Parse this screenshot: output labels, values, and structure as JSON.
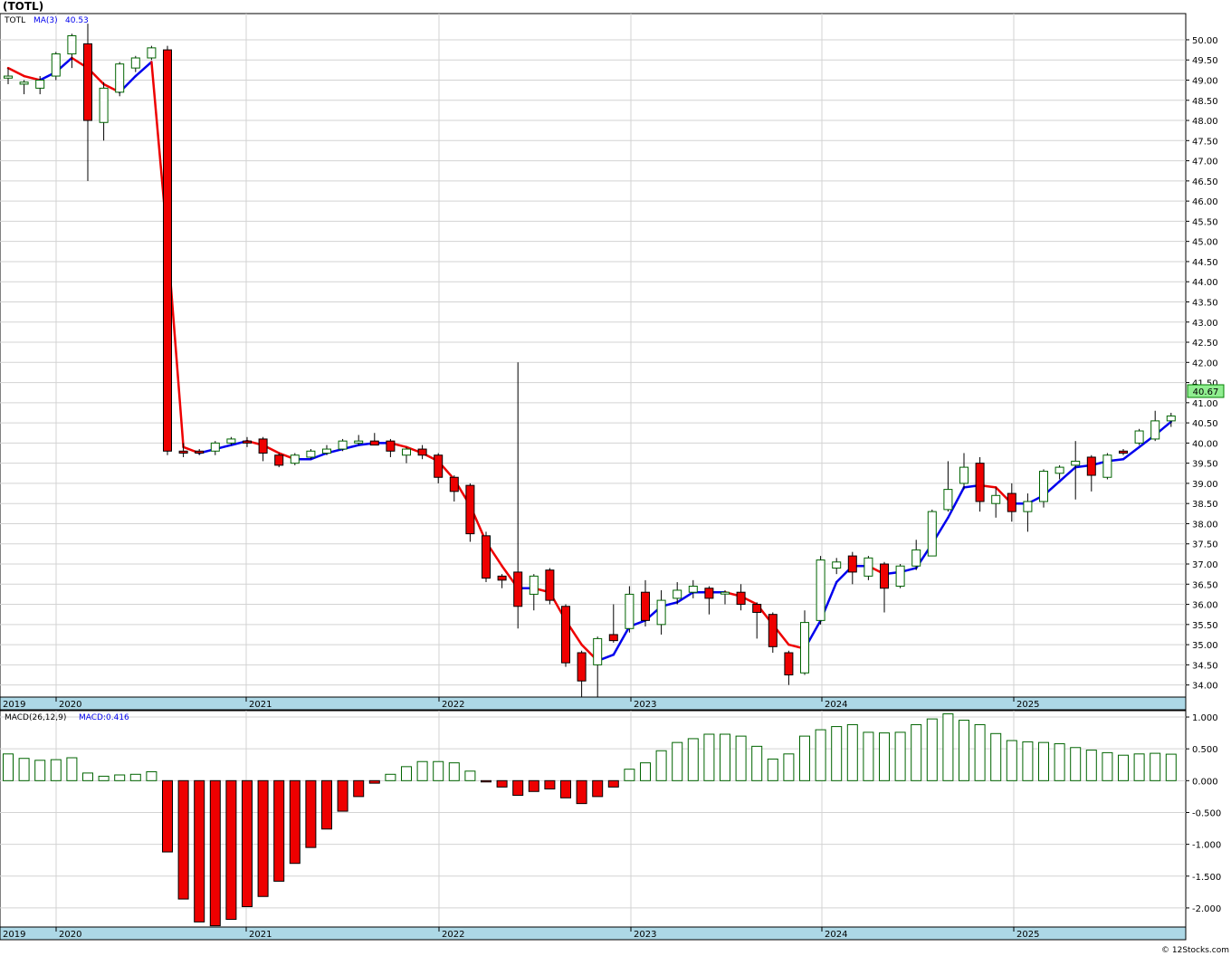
{
  "chart_data": [
    {
      "type": "candlestick",
      "title": "(TOTL)",
      "legend": {
        "symbol": "TOTL",
        "ma_label": "MA(3)",
        "ma_value": "40.53"
      },
      "last_price_label": "40.67",
      "ylim": [
        33.7,
        50.65
      ],
      "y_ticks": [
        "34.00",
        "34.50",
        "35.00",
        "35.50",
        "36.00",
        "36.50",
        "37.00",
        "37.50",
        "38.00",
        "38.50",
        "39.00",
        "39.50",
        "40.00",
        "40.50",
        "41.00",
        "41.50",
        "42.00",
        "42.50",
        "43.00",
        "43.50",
        "44.00",
        "44.50",
        "45.00",
        "45.50",
        "46.00",
        "46.50",
        "47.00",
        "47.50",
        "48.00",
        "48.50",
        "49.00",
        "49.50",
        "50.00"
      ],
      "x_labels": [
        "2019",
        "2020",
        "2021",
        "2022",
        "2023",
        "2024",
        "2025"
      ],
      "year_tick_positions_months": [
        0,
        3,
        15,
        27,
        39,
        51,
        63
      ],
      "candles": [
        {
          "m": 0,
          "o": 49.05,
          "h": 49.3,
          "l": 48.9,
          "c": 49.1
        },
        {
          "m": 1,
          "o": 48.9,
          "h": 49.0,
          "l": 48.65,
          "c": 48.95
        },
        {
          "m": 2,
          "o": 48.8,
          "h": 49.1,
          "l": 48.65,
          "c": 49.0
        },
        {
          "m": 3,
          "o": 49.1,
          "h": 49.7,
          "l": 49.0,
          "c": 49.65
        },
        {
          "m": 4,
          "o": 49.65,
          "h": 50.15,
          "l": 49.3,
          "c": 50.1
        },
        {
          "m": 5,
          "o": 49.9,
          "h": 50.4,
          "l": 46.5,
          "c": 48.0
        },
        {
          "m": 6,
          "o": 47.95,
          "h": 48.95,
          "l": 47.5,
          "c": 48.8
        },
        {
          "m": 7,
          "o": 48.7,
          "h": 49.45,
          "l": 48.6,
          "c": 49.4
        },
        {
          "m": 8,
          "o": 49.3,
          "h": 49.6,
          "l": 49.2,
          "c": 49.55
        },
        {
          "m": 9,
          "o": 49.55,
          "h": 49.85,
          "l": 49.5,
          "c": 49.8
        },
        {
          "m": 10,
          "o": 49.75,
          "h": 49.85,
          "l": 39.7,
          "c": 39.8
        },
        {
          "m": 11,
          "o": 39.8,
          "h": 40.0,
          "l": 39.65,
          "c": 39.75
        },
        {
          "m": 12,
          "o": 39.8,
          "h": 39.85,
          "l": 39.7,
          "c": 39.75
        },
        {
          "m": 13,
          "o": 39.8,
          "h": 40.05,
          "l": 39.7,
          "c": 40.0
        },
        {
          "m": 14,
          "o": 40.0,
          "h": 40.15,
          "l": 39.95,
          "c": 40.1
        },
        {
          "m": 15,
          "o": 40.05,
          "h": 40.15,
          "l": 39.9,
          "c": 40.0
        },
        {
          "m": 16,
          "o": 40.1,
          "h": 40.15,
          "l": 39.55,
          "c": 39.75
        },
        {
          "m": 17,
          "o": 39.7,
          "h": 39.75,
          "l": 39.4,
          "c": 39.45
        },
        {
          "m": 18,
          "o": 39.5,
          "h": 39.75,
          "l": 39.45,
          "c": 39.7
        },
        {
          "m": 19,
          "o": 39.65,
          "h": 39.85,
          "l": 39.6,
          "c": 39.8
        },
        {
          "m": 20,
          "o": 39.75,
          "h": 39.95,
          "l": 39.7,
          "c": 39.85
        },
        {
          "m": 21,
          "o": 39.85,
          "h": 40.1,
          "l": 39.8,
          "c": 40.05
        },
        {
          "m": 22,
          "o": 40.0,
          "h": 40.2,
          "l": 39.95,
          "c": 40.05
        },
        {
          "m": 23,
          "o": 40.05,
          "h": 40.25,
          "l": 39.95,
          "c": 39.95
        },
        {
          "m": 24,
          "o": 40.05,
          "h": 40.1,
          "l": 39.65,
          "c": 39.8
        },
        {
          "m": 25,
          "o": 39.7,
          "h": 39.9,
          "l": 39.5,
          "c": 39.85
        },
        {
          "m": 26,
          "o": 39.85,
          "h": 39.95,
          "l": 39.6,
          "c": 39.7
        },
        {
          "m": 27,
          "o": 39.7,
          "h": 39.75,
          "l": 39.0,
          "c": 39.15
        },
        {
          "m": 28,
          "o": 39.15,
          "h": 39.2,
          "l": 38.55,
          "c": 38.8
        },
        {
          "m": 29,
          "o": 38.95,
          "h": 39.0,
          "l": 37.55,
          "c": 37.75
        },
        {
          "m": 30,
          "o": 37.7,
          "h": 37.8,
          "l": 36.55,
          "c": 36.65
        },
        {
          "m": 31,
          "o": 36.7,
          "h": 36.75,
          "l": 36.4,
          "c": 36.6
        },
        {
          "m": 32,
          "o": 36.8,
          "h": 42.0,
          "l": 35.4,
          "c": 35.95
        },
        {
          "m": 33,
          "o": 36.25,
          "h": 36.75,
          "l": 35.85,
          "c": 36.7
        },
        {
          "m": 34,
          "o": 36.85,
          "h": 36.9,
          "l": 36.0,
          "c": 36.1
        },
        {
          "m": 35,
          "o": 35.95,
          "h": 36.0,
          "l": 34.45,
          "c": 34.55
        },
        {
          "m": 36,
          "o": 34.8,
          "h": 34.85,
          "l": 33.7,
          "c": 34.1
        },
        {
          "m": 37,
          "o": 34.5,
          "h": 35.2,
          "l": 33.65,
          "c": 35.15
        },
        {
          "m": 38,
          "o": 35.25,
          "h": 36.0,
          "l": 35.05,
          "c": 35.1
        },
        {
          "m": 39,
          "o": 35.4,
          "h": 36.45,
          "l": 35.3,
          "c": 36.25
        },
        {
          "m": 40,
          "o": 36.3,
          "h": 36.6,
          "l": 35.45,
          "c": 35.6
        },
        {
          "m": 41,
          "o": 35.5,
          "h": 36.35,
          "l": 35.25,
          "c": 36.1
        },
        {
          "m": 42,
          "o": 36.15,
          "h": 36.55,
          "l": 36.0,
          "c": 36.35
        },
        {
          "m": 43,
          "o": 36.3,
          "h": 36.6,
          "l": 36.15,
          "c": 36.45
        },
        {
          "m": 44,
          "o": 36.4,
          "h": 36.45,
          "l": 35.75,
          "c": 36.15
        },
        {
          "m": 45,
          "o": 36.3,
          "h": 36.35,
          "l": 36.0,
          "c": 36.3
        },
        {
          "m": 46,
          "o": 36.3,
          "h": 36.5,
          "l": 35.85,
          "c": 36.0
        },
        {
          "m": 47,
          "o": 36.0,
          "h": 36.05,
          "l": 35.15,
          "c": 35.8
        },
        {
          "m": 48,
          "o": 35.75,
          "h": 35.8,
          "l": 34.8,
          "c": 34.95
        },
        {
          "m": 49,
          "o": 34.8,
          "h": 34.85,
          "l": 34.0,
          "c": 34.25
        },
        {
          "m": 50,
          "o": 34.3,
          "h": 35.85,
          "l": 34.25,
          "c": 35.55
        },
        {
          "m": 51,
          "o": 35.6,
          "h": 37.2,
          "l": 35.5,
          "c": 37.1
        },
        {
          "m": 52,
          "o": 36.9,
          "h": 37.15,
          "l": 36.75,
          "c": 37.05
        },
        {
          "m": 53,
          "o": 37.2,
          "h": 37.3,
          "l": 36.5,
          "c": 36.8
        },
        {
          "m": 54,
          "o": 36.7,
          "h": 37.2,
          "l": 36.6,
          "c": 37.15
        },
        {
          "m": 55,
          "o": 37.0,
          "h": 37.05,
          "l": 35.8,
          "c": 36.4
        },
        {
          "m": 56,
          "o": 36.45,
          "h": 37.0,
          "l": 36.4,
          "c": 36.95
        },
        {
          "m": 57,
          "o": 36.95,
          "h": 37.6,
          "l": 36.85,
          "c": 37.35
        },
        {
          "m": 58,
          "o": 37.2,
          "h": 38.35,
          "l": 37.2,
          "c": 38.3
        },
        {
          "m": 59,
          "o": 38.35,
          "h": 39.55,
          "l": 38.3,
          "c": 38.85
        },
        {
          "m": 60,
          "o": 39.0,
          "h": 39.75,
          "l": 38.85,
          "c": 39.4
        },
        {
          "m": 61,
          "o": 39.5,
          "h": 39.65,
          "l": 38.3,
          "c": 38.55
        },
        {
          "m": 62,
          "o": 38.5,
          "h": 38.9,
          "l": 38.15,
          "c": 38.7
        },
        {
          "m": 63,
          "o": 38.75,
          "h": 39.0,
          "l": 38.05,
          "c": 38.3
        },
        {
          "m": 64,
          "o": 38.3,
          "h": 38.75,
          "l": 37.8,
          "c": 38.55
        },
        {
          "m": 65,
          "o": 38.55,
          "h": 39.35,
          "l": 38.4,
          "c": 39.3
        },
        {
          "m": 66,
          "o": 39.25,
          "h": 39.45,
          "l": 39.1,
          "c": 39.4
        },
        {
          "m": 67,
          "o": 39.45,
          "h": 40.05,
          "l": 38.6,
          "c": 39.55
        },
        {
          "m": 68,
          "o": 39.65,
          "h": 39.7,
          "l": 38.8,
          "c": 39.2
        },
        {
          "m": 69,
          "o": 39.15,
          "h": 39.75,
          "l": 39.1,
          "c": 39.7
        },
        {
          "m": 70,
          "o": 39.8,
          "h": 39.85,
          "l": 39.7,
          "c": 39.75
        },
        {
          "m": 71,
          "o": 40.0,
          "h": 40.35,
          "l": 39.95,
          "c": 40.3
        },
        {
          "m": 72,
          "o": 40.1,
          "h": 40.8,
          "l": 40.05,
          "c": 40.55
        },
        {
          "m": 73,
          "o": 40.55,
          "h": 40.75,
          "l": 40.4,
          "c": 40.67
        }
      ],
      "ma3": [
        49.3,
        49.1,
        49.0,
        49.2,
        49.55,
        49.3,
        48.9,
        48.7,
        49.1,
        49.45,
        45.0,
        39.9,
        39.75,
        39.85,
        39.95,
        40.05,
        39.95,
        39.75,
        39.6,
        39.6,
        39.75,
        39.85,
        39.95,
        40.0,
        40.0,
        39.9,
        39.75,
        39.55,
        39.1,
        38.45,
        37.55,
        36.95,
        36.4,
        36.4,
        36.3,
        35.6,
        35.0,
        34.6,
        34.75,
        35.45,
        35.6,
        35.95,
        36.05,
        36.3,
        36.3,
        36.3,
        36.2,
        36.0,
        35.5,
        35.0,
        34.9,
        35.6,
        36.55,
        36.95,
        36.95,
        36.75,
        36.8,
        36.9,
        37.5,
        38.15,
        38.9,
        38.95,
        38.9,
        38.5,
        38.5,
        38.7,
        39.05,
        39.4,
        39.45,
        39.55,
        39.6,
        39.9,
        40.2,
        40.53
      ],
      "ma_color_up": "#0000ee",
      "ma_color_down": "#ee0000"
    },
    {
      "type": "bar",
      "title": "MACD(26,12,9)",
      "legend": {
        "label": "MACD(26,12,9)",
        "value_label": "MACD:0.416"
      },
      "ylim": [
        -2.3,
        1.1
      ],
      "y_ticks": [
        "1.000",
        "0.500",
        "0.000",
        "-0.500",
        "-1.000",
        "-1.500",
        "-2.000"
      ],
      "x_labels": [
        "2019",
        "2020",
        "2021",
        "2022",
        "2023",
        "2024",
        "2025"
      ],
      "values": [
        0.42,
        0.35,
        0.32,
        0.33,
        0.36,
        0.12,
        0.07,
        0.09,
        0.1,
        0.14,
        -1.12,
        -1.86,
        -2.22,
        -2.28,
        -2.18,
        -1.98,
        -1.82,
        -1.58,
        -1.3,
        -1.05,
        -0.76,
        -0.48,
        -0.25,
        -0.04,
        0.1,
        0.22,
        0.3,
        0.3,
        0.28,
        0.15,
        -0.02,
        -0.1,
        -0.23,
        -0.17,
        -0.13,
        -0.27,
        -0.36,
        -0.25,
        -0.1,
        0.18,
        0.28,
        0.47,
        0.6,
        0.66,
        0.73,
        0.73,
        0.7,
        0.54,
        0.34,
        0.42,
        0.7,
        0.8,
        0.85,
        0.88,
        0.76,
        0.75,
        0.76,
        0.88,
        0.97,
        1.05,
        0.95,
        0.88,
        0.74,
        0.63,
        0.61,
        0.6,
        0.58,
        0.52,
        0.48,
        0.44,
        0.4,
        0.42,
        0.43,
        0.416
      ],
      "pos_color": "#006400",
      "neg_color": "#ee0000"
    }
  ],
  "footer": {
    "credit": "© 12Stocks.com"
  }
}
